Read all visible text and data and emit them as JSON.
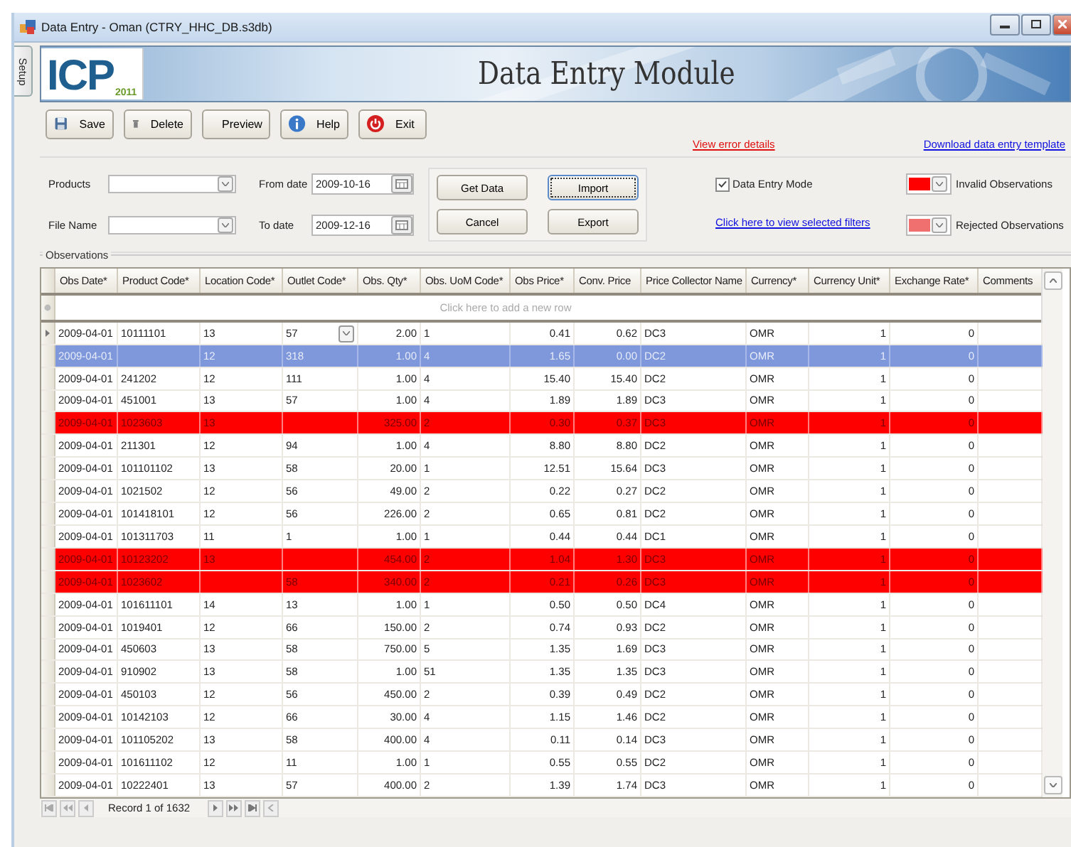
{
  "window": {
    "title": "Data Entry - Oman (CTRY_HHC_DB.s3db)"
  },
  "side_tab": "Setup",
  "banner": {
    "logo_text": "ICP",
    "logo_year": "2011",
    "title": "Data Entry Module"
  },
  "toolbar": {
    "buttons": [
      {
        "label": "Save"
      },
      {
        "label": "Delete"
      },
      {
        "label": "Preview"
      },
      {
        "label": "Help"
      },
      {
        "label": "Exit"
      }
    ],
    "links": [
      {
        "label": "View error details",
        "kind": "error"
      },
      {
        "label": "Download data entry template",
        "kind": "link"
      }
    ]
  },
  "filters": {
    "products": {
      "label": "Products"
    },
    "file_name": {
      "label": "File Name"
    },
    "from_date": {
      "label": "From date",
      "value": "2009-10-16"
    },
    "to_date": {
      "label": "To date",
      "value": "2009-12-16"
    },
    "actions": [
      {
        "label": "Get Data",
        "focused": false
      },
      {
        "label": "Import",
        "focused": true
      },
      {
        "label": "Cancel",
        "focused": false
      },
      {
        "label": "Export",
        "focused": false
      }
    ],
    "data_entry_mode": {
      "label": "Data Entry Mode",
      "checked": true
    },
    "filters_link": "Click here to view selected filters",
    "legend": [
      {
        "label": "Invalid Observations",
        "color": "#ff0000"
      },
      {
        "label": "Rejected Observations",
        "color": "#f07070"
      }
    ]
  },
  "observations": {
    "title": "Observations",
    "columns": [
      {
        "label": "Obs Date*",
        "kind": "text"
      },
      {
        "label": "Product Code*",
        "kind": "text"
      },
      {
        "label": "Location Code*",
        "kind": "text"
      },
      {
        "label": "Outlet Code*",
        "kind": "text"
      },
      {
        "label": "Obs. Qty*",
        "kind": "number"
      },
      {
        "label": "Obs. UoM Code*",
        "kind": "text"
      },
      {
        "label": "Obs Price*",
        "kind": "number"
      },
      {
        "label": "Conv. Price",
        "kind": "number"
      },
      {
        "label": "Price Collector Name",
        "kind": "text"
      },
      {
        "label": "Currency*",
        "kind": "text"
      },
      {
        "label": "Currency Unit*",
        "kind": "number"
      },
      {
        "label": "Exchange Rate*",
        "kind": "number"
      },
      {
        "label": "Comments",
        "kind": "text"
      }
    ],
    "new_row_hint": "Click here to add a new row",
    "rows": [
      {
        "cells": [
          "2009-04-01",
          "10111101",
          "13",
          "57",
          "2.00",
          "1",
          "0.41",
          "0.62",
          "DC3",
          "OMR",
          "1",
          "0",
          ""
        ],
        "current": true,
        "selected": false,
        "invalid": false
      },
      {
        "cells": [
          "2009-04-01",
          "",
          "12",
          "318",
          "1.00",
          "4",
          "1.65",
          "0.00",
          "DC2",
          "OMR",
          "1",
          "0",
          ""
        ],
        "current": false,
        "selected": true,
        "invalid": false
      },
      {
        "cells": [
          "2009-04-01",
          "241202",
          "12",
          "111",
          "1.00",
          "4",
          "15.40",
          "15.40",
          "DC2",
          "OMR",
          "1",
          "0",
          ""
        ],
        "current": false,
        "selected": false,
        "invalid": false
      },
      {
        "cells": [
          "2009-04-01",
          "451001",
          "13",
          "57",
          "1.00",
          "4",
          "1.89",
          "1.89",
          "DC3",
          "OMR",
          "1",
          "0",
          ""
        ],
        "current": false,
        "selected": false,
        "invalid": false
      },
      {
        "cells": [
          "2009-04-01",
          "1023603",
          "13",
          "",
          "325.00",
          "2",
          "0.30",
          "0.37",
          "DC3",
          "OMR",
          "1",
          "0",
          ""
        ],
        "current": false,
        "selected": false,
        "invalid": true
      },
      {
        "cells": [
          "2009-04-01",
          "211301",
          "12",
          "94",
          "1.00",
          "4",
          "8.80",
          "8.80",
          "DC2",
          "OMR",
          "1",
          "0",
          ""
        ],
        "current": false,
        "selected": false,
        "invalid": false
      },
      {
        "cells": [
          "2009-04-01",
          "101101102",
          "13",
          "58",
          "20.00",
          "1",
          "12.51",
          "15.64",
          "DC3",
          "OMR",
          "1",
          "0",
          ""
        ],
        "current": false,
        "selected": false,
        "invalid": false
      },
      {
        "cells": [
          "2009-04-01",
          "1021502",
          "12",
          "56",
          "49.00",
          "2",
          "0.22",
          "0.27",
          "DC2",
          "OMR",
          "1",
          "0",
          ""
        ],
        "current": false,
        "selected": false,
        "invalid": false
      },
      {
        "cells": [
          "2009-04-01",
          "101418101",
          "12",
          "56",
          "226.00",
          "2",
          "0.65",
          "0.81",
          "DC2",
          "OMR",
          "1",
          "0",
          ""
        ],
        "current": false,
        "selected": false,
        "invalid": false
      },
      {
        "cells": [
          "2009-04-01",
          "101311703",
          "11",
          "1",
          "1.00",
          "1",
          "0.44",
          "0.44",
          "DC1",
          "OMR",
          "1",
          "0",
          ""
        ],
        "current": false,
        "selected": false,
        "invalid": false
      },
      {
        "cells": [
          "2009-04-01",
          "10123202",
          "13",
          "",
          "454.00",
          "2",
          "1.04",
          "1.30",
          "DC3",
          "OMR",
          "1",
          "0",
          ""
        ],
        "current": false,
        "selected": false,
        "invalid": true
      },
      {
        "cells": [
          "2009-04-01",
          "1023602",
          "",
          "58",
          "340.00",
          "2",
          "0.21",
          "0.26",
          "DC3",
          "OMR",
          "1",
          "0",
          ""
        ],
        "current": false,
        "selected": false,
        "invalid": true
      },
      {
        "cells": [
          "2009-04-01",
          "101611101",
          "14",
          "13",
          "1.00",
          "1",
          "0.50",
          "0.50",
          "DC4",
          "OMR",
          "1",
          "0",
          ""
        ],
        "current": false,
        "selected": false,
        "invalid": false
      },
      {
        "cells": [
          "2009-04-01",
          "1019401",
          "12",
          "66",
          "150.00",
          "2",
          "0.74",
          "0.93",
          "DC2",
          "OMR",
          "1",
          "0",
          ""
        ],
        "current": false,
        "selected": false,
        "invalid": false
      },
      {
        "cells": [
          "2009-04-01",
          "450603",
          "13",
          "58",
          "750.00",
          "5",
          "1.35",
          "1.69",
          "DC3",
          "OMR",
          "1",
          "0",
          ""
        ],
        "current": false,
        "selected": false,
        "invalid": false
      },
      {
        "cells": [
          "2009-04-01",
          "910902",
          "13",
          "58",
          "1.00",
          "51",
          "1.35",
          "1.35",
          "DC3",
          "OMR",
          "1",
          "0",
          ""
        ],
        "current": false,
        "selected": false,
        "invalid": false
      },
      {
        "cells": [
          "2009-04-01",
          "450103",
          "12",
          "56",
          "450.00",
          "2",
          "0.39",
          "0.49",
          "DC2",
          "OMR",
          "1",
          "0",
          ""
        ],
        "current": false,
        "selected": false,
        "invalid": false
      },
      {
        "cells": [
          "2009-04-01",
          "10142103",
          "12",
          "66",
          "30.00",
          "4",
          "1.15",
          "1.46",
          "DC2",
          "OMR",
          "1",
          "0",
          ""
        ],
        "current": false,
        "selected": false,
        "invalid": false
      },
      {
        "cells": [
          "2009-04-01",
          "101105202",
          "13",
          "58",
          "400.00",
          "4",
          "0.11",
          "0.14",
          "DC3",
          "OMR",
          "1",
          "0",
          ""
        ],
        "current": false,
        "selected": false,
        "invalid": false
      },
      {
        "cells": [
          "2009-04-01",
          "101611102",
          "12",
          "11",
          "1.00",
          "1",
          "0.55",
          "0.55",
          "DC2",
          "OMR",
          "1",
          "0",
          ""
        ],
        "current": false,
        "selected": false,
        "invalid": false
      },
      {
        "cells": [
          "2009-04-01",
          "10222401",
          "13",
          "57",
          "400.00",
          "2",
          "1.39",
          "1.74",
          "DC3",
          "OMR",
          "1",
          "0",
          ""
        ],
        "current": false,
        "selected": false,
        "invalid": false
      }
    ],
    "navigator": {
      "record": "Record 1 of 1632"
    }
  }
}
